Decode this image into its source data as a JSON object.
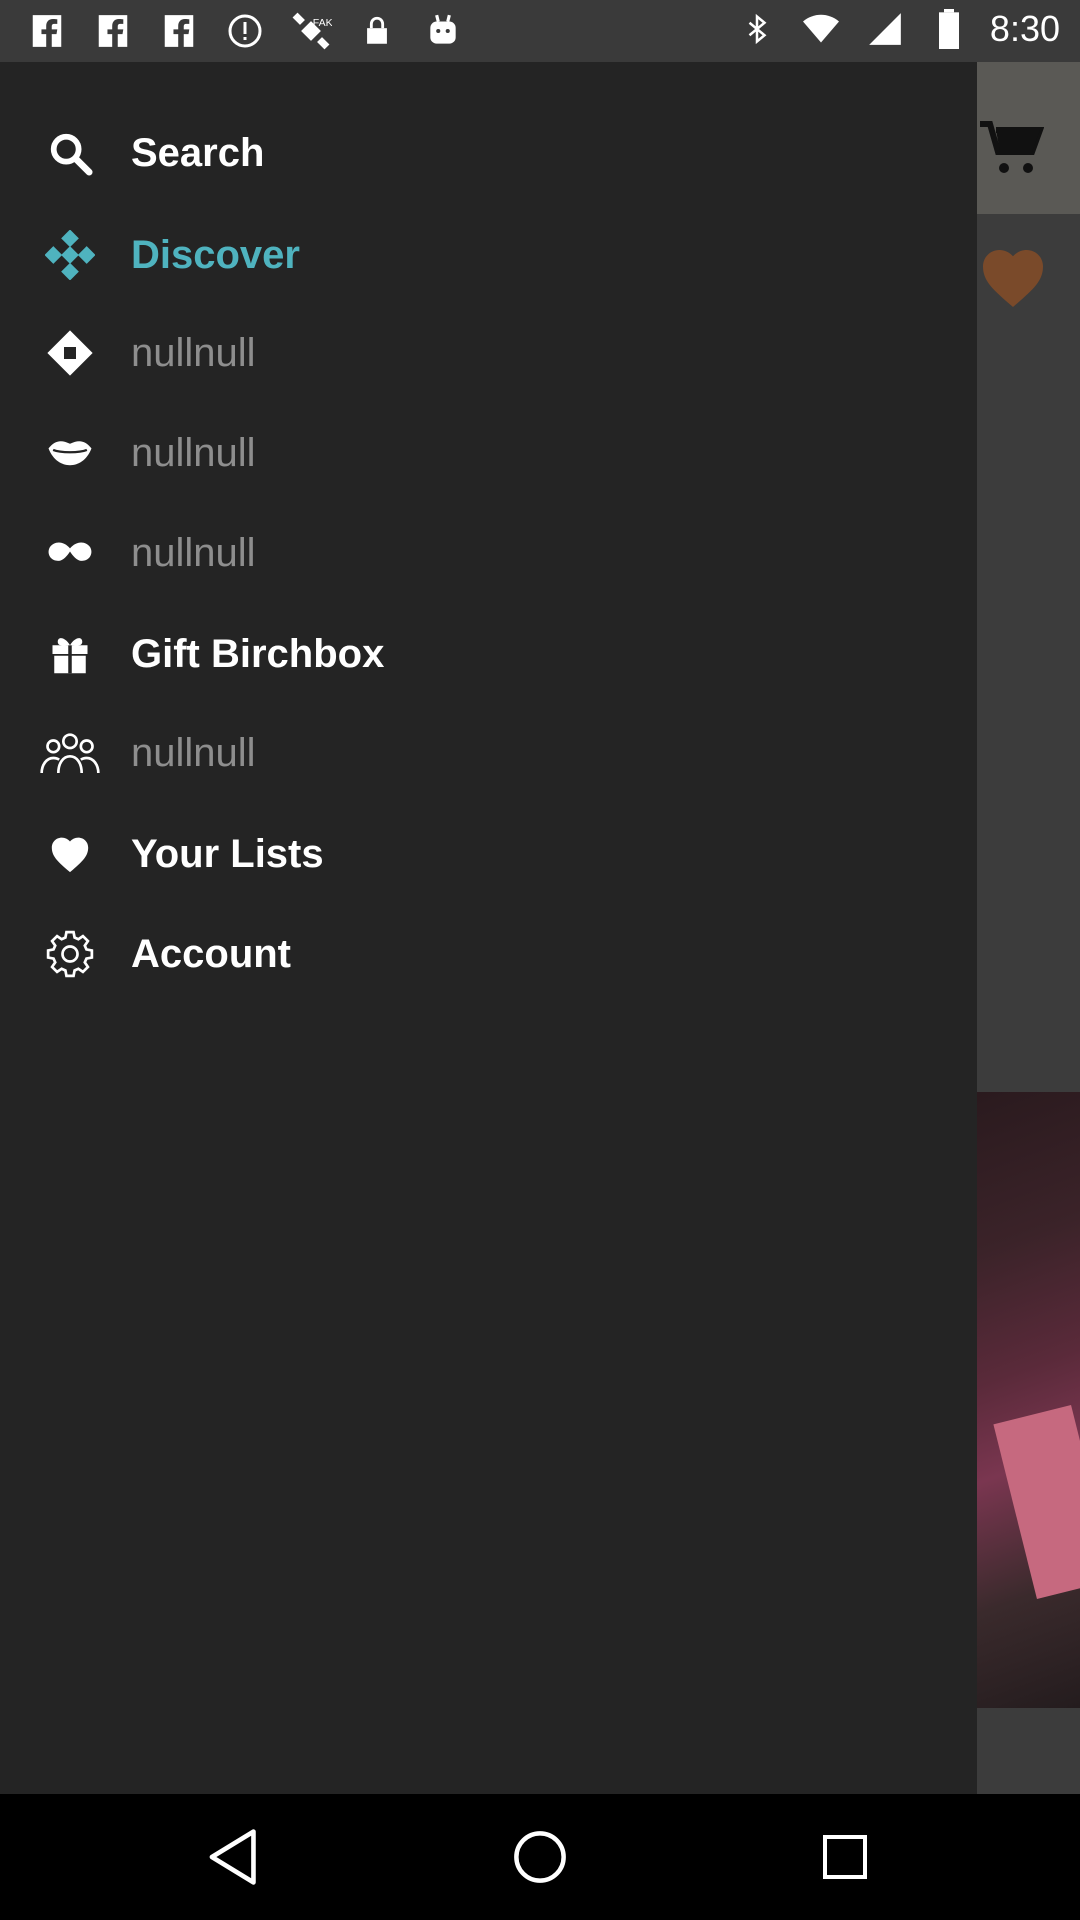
{
  "status_bar": {
    "time": "8:30",
    "left_icons": [
      "facebook-icon",
      "facebook-icon",
      "facebook-icon",
      "alert-icon",
      "satellite-icon",
      "lock-icon",
      "android-icon"
    ],
    "right_icons": [
      "bluetooth-icon",
      "wifi-icon",
      "signal-icon",
      "battery-icon"
    ]
  },
  "drawer": {
    "accent_color": "#4fb3bf",
    "items": [
      {
        "label": "Search",
        "icon": "search-icon",
        "state": "normal"
      },
      {
        "label": "Discover",
        "icon": "discover-icon",
        "state": "active"
      },
      {
        "label": "nullnull",
        "icon": "diamond-icon",
        "state": "muted"
      },
      {
        "label": "nullnull",
        "icon": "lips-icon",
        "state": "muted"
      },
      {
        "label": "nullnull",
        "icon": "mustache-icon",
        "state": "muted"
      },
      {
        "label": "Gift Birchbox",
        "icon": "gift-icon",
        "state": "normal"
      },
      {
        "label": "nullnull",
        "icon": "people-icon",
        "state": "muted"
      },
      {
        "label": "Your Lists",
        "icon": "heart-icon",
        "state": "normal"
      },
      {
        "label": "Account",
        "icon": "gear-icon",
        "state": "normal"
      }
    ]
  },
  "background_app": {
    "icons": [
      "cart-icon",
      "heart-icon"
    ]
  },
  "nav_bar": {
    "buttons": [
      "back-button",
      "home-button",
      "recents-button"
    ]
  }
}
